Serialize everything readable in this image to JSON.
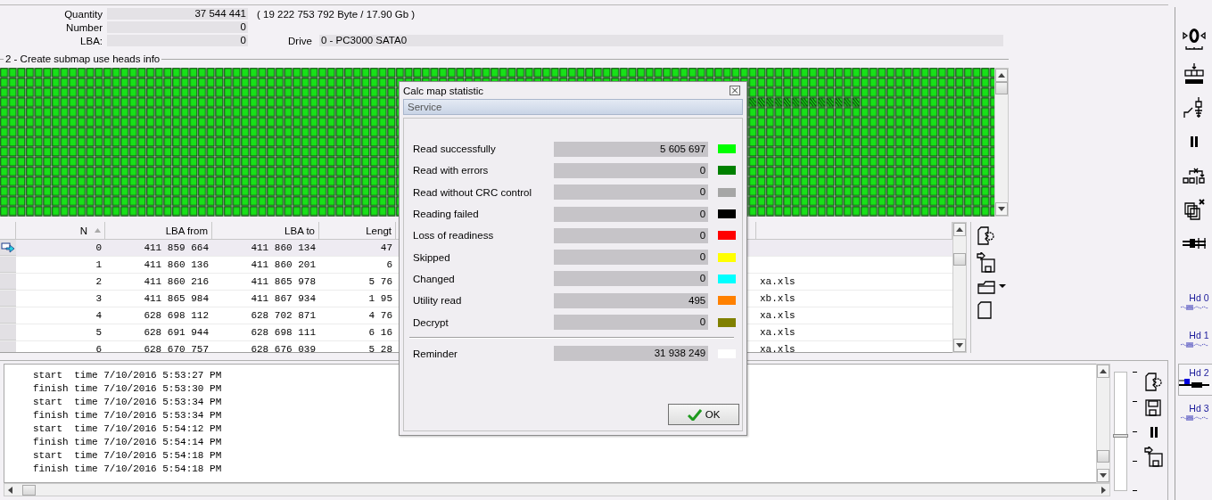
{
  "info": {
    "quantity": {
      "label": "Quantity",
      "value": "37 544 441",
      "extra": "( 19 222 753 792 Byte /  17.90 Gb )"
    },
    "number": {
      "label": "Number",
      "value": "0"
    },
    "lba": {
      "label": "LBA:",
      "value": "0"
    },
    "drive": {
      "label": "Drive",
      "value": "0 - PC3000 SATA0"
    }
  },
  "map": {
    "title": "2 - Create submap use heads info"
  },
  "table": {
    "columns": [
      "N",
      "LBA from",
      "LBA to",
      "Lengt"
    ],
    "rows": [
      {
        "n": "0",
        "lba_from": "411 859 664",
        "lba_to": "411 860 134",
        "length": "47",
        "selected": true
      },
      {
        "n": "1",
        "lba_from": "411 860 136",
        "lba_to": "411 860 201",
        "length": "6",
        "selected": false
      },
      {
        "n": "2",
        "lba_from": "411 860 216",
        "lba_to": "411 865 978",
        "length": "5 76",
        "file": "xa.xls",
        "selected": false
      },
      {
        "n": "3",
        "lba_from": "411 865 984",
        "lba_to": "411 867 934",
        "length": "1 95",
        "file": "xb.xls",
        "selected": false
      },
      {
        "n": "4",
        "lba_from": "628 698 112",
        "lba_to": "628 702 871",
        "length": "4 76",
        "file": "xa.xls",
        "selected": false
      },
      {
        "n": "5",
        "lba_from": "628 691 944",
        "lba_to": "628 698 111",
        "length": "6 16",
        "file": "xa.xls",
        "selected": false
      },
      {
        "n": "6",
        "lba_from": "628 670 757",
        "lba_to": "628 676 039",
        "length": "5 28",
        "file": "xa.xls",
        "selected": false
      }
    ]
  },
  "log": {
    "lines": [
      "start  time 7/10/2016 5:53:27 PM",
      "finish time 7/10/2016 5:53:30 PM",
      "start  time 7/10/2016 5:53:34 PM",
      "finish time 7/10/2016 5:53:34 PM",
      "start  time 7/10/2016 5:54:12 PM",
      "finish time 7/10/2016 5:54:14 PM",
      "start  time 7/10/2016 5:54:18 PM",
      "finish time 7/10/2016 5:54:18 PM"
    ],
    "slider": {
      "level": 0.47
    }
  },
  "heads": [
    {
      "label": "Hd 0",
      "selected": false
    },
    {
      "label": "Hd 1",
      "selected": false
    },
    {
      "label": "Hd 2",
      "selected": true
    },
    {
      "label": "Hd 3",
      "selected": false
    }
  ],
  "dialog": {
    "title": "Calc map statistic",
    "menu": [
      "Service"
    ],
    "stats": [
      {
        "label": "Read successfully",
        "value": "5 605 697",
        "color": "#00ff00"
      },
      {
        "label": "Read with errors",
        "value": "0",
        "color": "#008000"
      },
      {
        "label": "Read without CRC control",
        "value": "0",
        "color": "#a6a6a6"
      },
      {
        "label": "Reading failed",
        "value": "0",
        "color": "#000000"
      },
      {
        "label": "Loss of readiness",
        "value": "0",
        "color": "#ff0000"
      },
      {
        "label": "Skipped",
        "value": "0",
        "color": "#ffff00"
      },
      {
        "label": "Changed",
        "value": "0",
        "color": "#00ffff"
      },
      {
        "label": "Utility read",
        "value": "495",
        "color": "#ff8000"
      },
      {
        "label": "Decrypt",
        "value": "0",
        "color": "#808000"
      }
    ],
    "reminder": {
      "label": "Reminder",
      "value": "31 938 249",
      "color": "#ffffff"
    },
    "ok_button": "OK"
  }
}
